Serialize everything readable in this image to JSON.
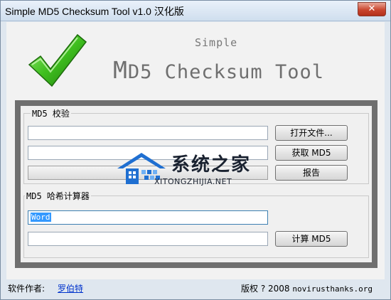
{
  "window": {
    "title": "Simple MD5 Checksum Tool v1.0 汉化版",
    "close_label": "✕"
  },
  "banner": {
    "subtitle": "Simple",
    "title_first": "M",
    "title_second": "D5 Checksum Tool"
  },
  "verify": {
    "group_label": "MD5 校验",
    "file_path_value": "",
    "md5_value": "",
    "open_file_label": "打开文件...",
    "get_md5_label": "获取 MD5",
    "report_label": "报告"
  },
  "calculator": {
    "group_label": "MD5 哈希计算器",
    "input_value": "Word",
    "output_value": "",
    "calculate_label": "计算 MD5"
  },
  "watermark": {
    "brand": "系统之家",
    "site": "XITONGZHIJIA.NET"
  },
  "footer": {
    "author_label": "软件作者:",
    "author_name": "罗伯特",
    "copyright_prefix": "版权 ? 2008",
    "copyright_site": "novirusthanks.org"
  },
  "colors": {
    "accent": "#3399ff",
    "check_green": "#3fbf1f",
    "link": "#0033cc"
  }
}
